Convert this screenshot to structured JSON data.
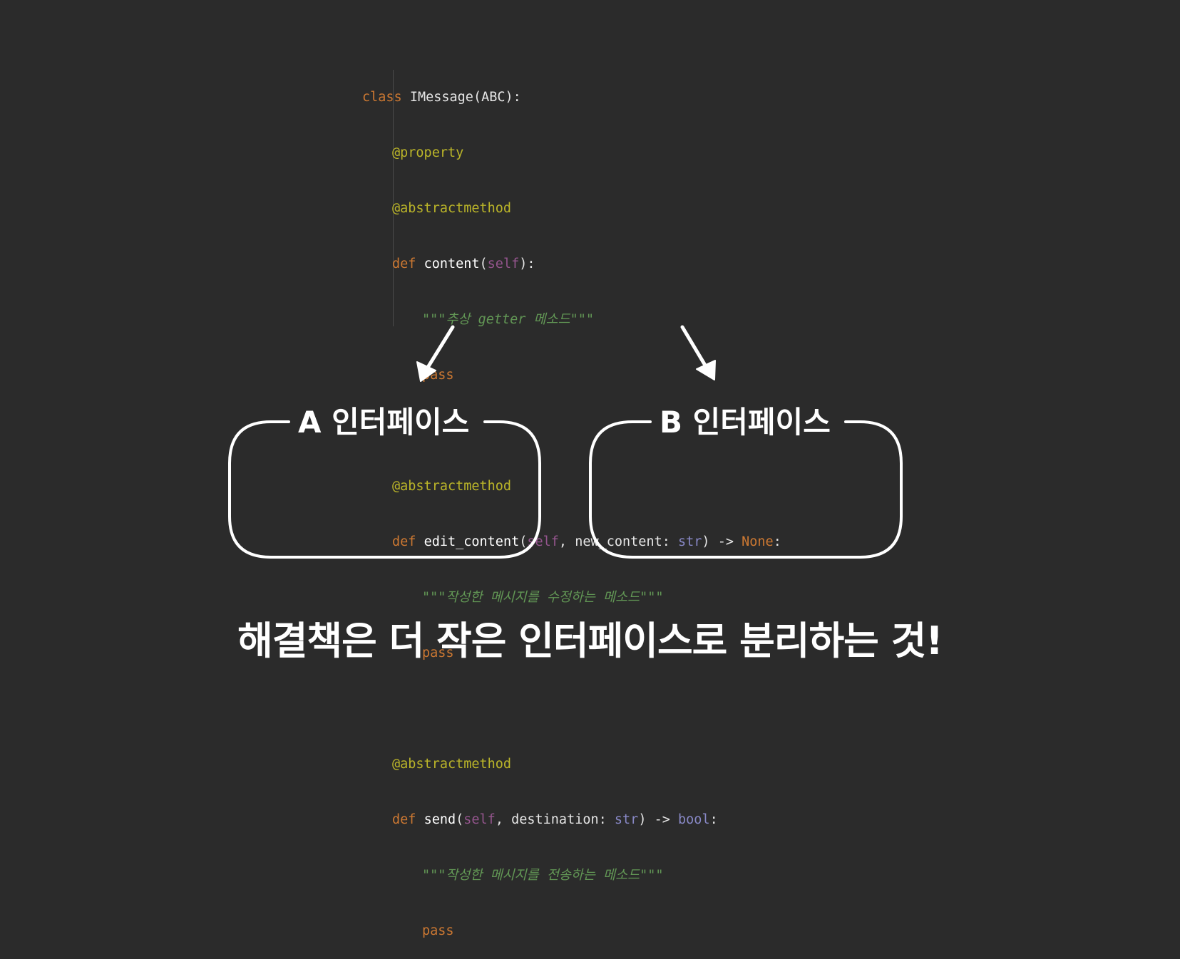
{
  "code": {
    "class_kw": "class",
    "class_name": "IMessage(ABC):",
    "property_dec": "@property",
    "abstract_dec": "@abstractmethod",
    "def_kw": "def",
    "m1_name": "content",
    "m1_params_open": "(",
    "self": "self",
    "m1_params_close": "):",
    "m1_doc": "\"\"\"추상 getter 메소드\"\"\"",
    "pass": "pass",
    "m2_name": "edit_content",
    "m2_open": "(",
    "m2_mid": ", new_content: ",
    "str": "str",
    "m2_arrow": ") -> ",
    "none": "None",
    "colon": ":",
    "m2_doc": "\"\"\"작성한 메시지를 수정하는 메소드\"\"\"",
    "m3_name": "send",
    "m3_open": "(",
    "m3_mid": ", destination: ",
    "m3_arrow": ") -> ",
    "bool": "bool",
    "m3_doc": "\"\"\"작성한 메시지를 전송하는 메소드\"\"\""
  },
  "diagram": {
    "box_a_title": "A 인터페이스",
    "box_b_title": "B 인터페이스"
  },
  "caption": "해결책은 더 작은 인터페이스로 분리하는 것!",
  "colors": {
    "background": "#2b2b2b",
    "keyword": "#cc7832",
    "decorator": "#bbb529",
    "self": "#94558d",
    "docstring": "#629755",
    "builtin_type": "#8888c6",
    "outline": "#ffffff"
  }
}
